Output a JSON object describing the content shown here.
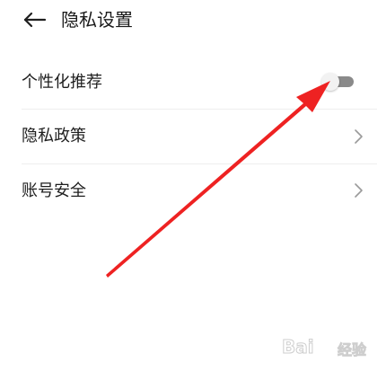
{
  "header": {
    "back_icon": "arrow-left-icon",
    "title": "隐私设置"
  },
  "settings": {
    "personalized": {
      "label": "个性化推荐",
      "enabled": false
    },
    "privacy_policy": {
      "label": "隐私政策",
      "icon": "chevron-right-icon"
    },
    "account_security": {
      "label": "账号安全",
      "icon": "chevron-right-icon"
    }
  },
  "colors": {
    "annotation_arrow": "#ee2222",
    "toggle_track": "#8a8a8a",
    "toggle_knob": "#f2f2f2",
    "chevron": "#9a9a9a",
    "divider": "#eeeeee"
  },
  "watermark": {
    "text": "Bai",
    "sub": "经验"
  }
}
